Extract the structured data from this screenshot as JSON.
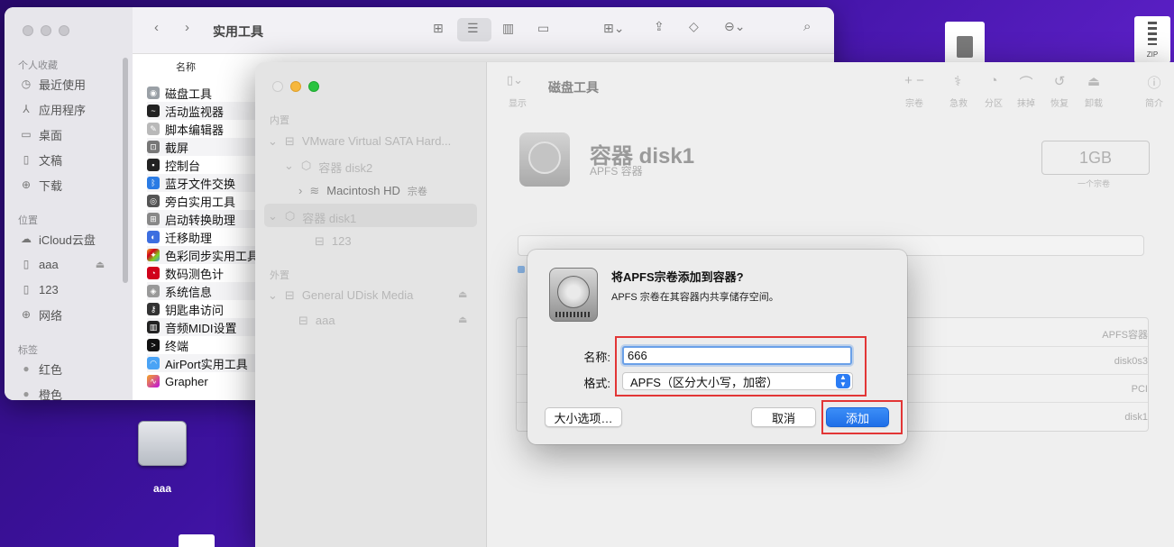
{
  "finder": {
    "title": "实用工具",
    "sidebar": {
      "favorites_header": "个人收藏",
      "favorites": [
        "最近使用",
        "应用程序",
        "桌面",
        "文稿",
        "下载"
      ],
      "locations_header": "位置",
      "locations": [
        "iCloud云盘",
        "aaa",
        "123",
        "网络"
      ],
      "tags_header": "标签",
      "tags": [
        "红色",
        "橙色"
      ]
    },
    "column_name": "名称",
    "files": [
      "磁盘工具",
      "活动监视器",
      "脚本编辑器",
      "截屏",
      "控制台",
      "蓝牙文件交换",
      "旁白实用工具",
      "启动转换助理",
      "迁移助理",
      "色彩同步实用工具",
      "数码测色计",
      "系统信息",
      "钥匙串访问",
      "音频MIDI设置",
      "终端",
      "AirPort实用工具",
      "Grapher"
    ]
  },
  "disk_utility": {
    "title": "磁盘工具",
    "view_label": "显示",
    "tools": [
      "宗卷",
      "急救",
      "分区",
      "抹掉",
      "恢复",
      "卸载",
      "简介"
    ],
    "sidebar": {
      "internal_header": "内置",
      "drive": "VMware Virtual SATA Hard...",
      "container2": "容器 disk2",
      "macintosh_hd": "Macintosh HD",
      "macintosh_hd_tag": "宗卷",
      "container1": "容器 disk1",
      "vol_123": "123",
      "external_header": "外置",
      "usb": "General UDisk Media",
      "vol_aaa": "aaa"
    },
    "header": {
      "name": "容器 disk1",
      "subtitle": "APFS 容器",
      "size": "1GB",
      "size_caption": "一个宗卷"
    },
    "info_values": [
      "APFS容器",
      "disk0s3",
      "PCI",
      "disk1"
    ]
  },
  "dialog": {
    "title": "将APFS宗卷添加到容器?",
    "subtitle": "APFS 宗卷在其容器内共享储存空间。",
    "name_label": "名称:",
    "name_value": "666",
    "format_label": "格式:",
    "format_value": "APFS（区分大小写，加密）",
    "size_options_button": "大小选项…",
    "cancel_button": "取消",
    "add_button": "添加"
  },
  "desktop": {
    "drive_label": "aaa",
    "zip_label": "ZIP"
  },
  "colors": {
    "accent": "#1f6fe8",
    "highlight": "#e23636"
  }
}
